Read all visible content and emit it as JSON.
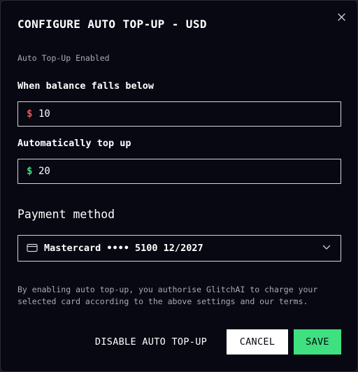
{
  "dialog": {
    "title": "CONFIGURE AUTO TOP-UP - USD",
    "close_icon": "close-icon",
    "status_text": "Auto Top-Up Enabled"
  },
  "threshold": {
    "label": "When balance falls below",
    "currency_symbol": "$",
    "value": "10",
    "symbol_color": "#f0575a"
  },
  "topup": {
    "label": "Automatically top up",
    "currency_symbol": "$",
    "value": "20",
    "symbol_color": "#3ee07f"
  },
  "payment": {
    "heading": "Payment method",
    "selected_card": "Mastercard •••• 5100 12/2027",
    "card_icon": "credit-card-icon",
    "dropdown_icon": "chevron-down-icon"
  },
  "disclaimer": "By enabling auto top-up, you authorise GlitchAI to charge your selected card according to the above settings and our terms.",
  "buttons": {
    "disable_label": "DISABLE AUTO TOP-UP",
    "cancel_label": "CANCEL",
    "save_label": "SAVE"
  },
  "colors": {
    "background": "#070812",
    "accent_green": "#3ee07f",
    "accent_red": "#f0575a"
  }
}
